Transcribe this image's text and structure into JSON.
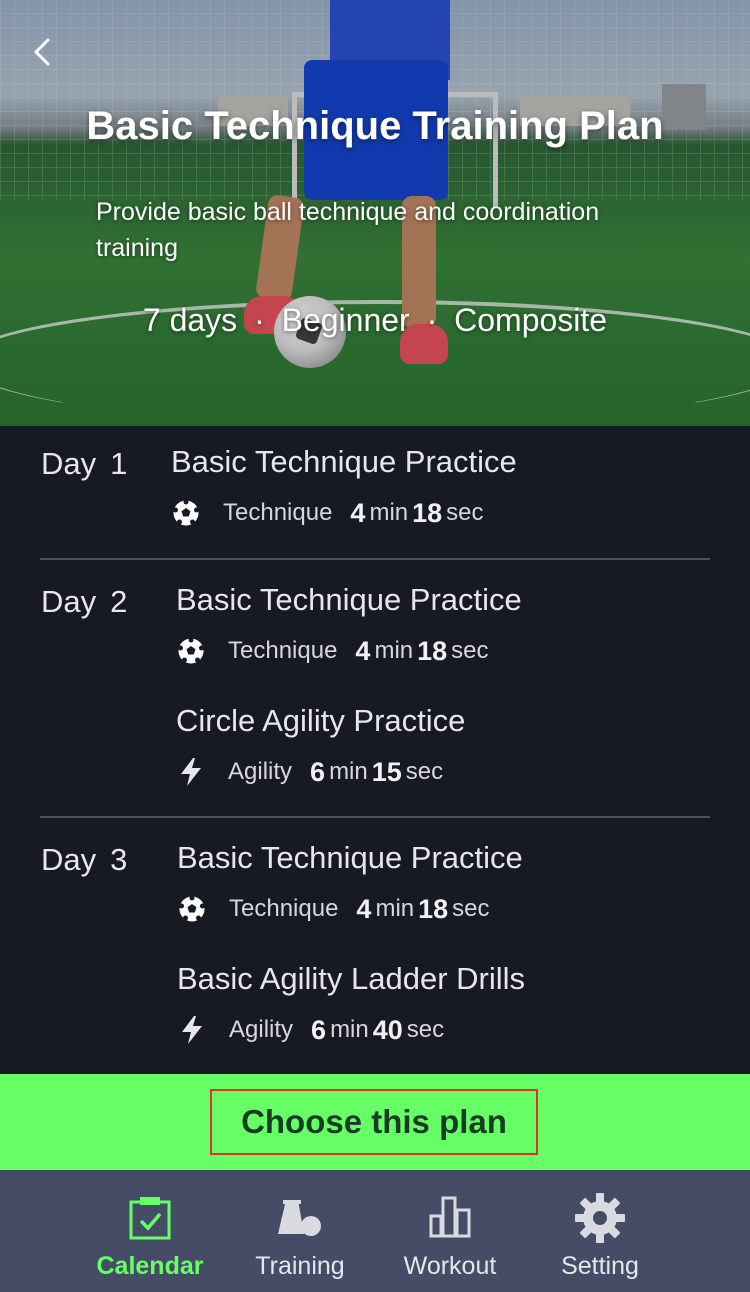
{
  "header": {
    "title": "Basic Technique Training Plan",
    "subtitle": "Provide basic ball technique and coordination training",
    "meta": {
      "duration": "7 days",
      "level": "Beginner",
      "type": "Composite",
      "separator": "·"
    }
  },
  "days": [
    {
      "label": "Day",
      "number": "1",
      "exercises": [
        {
          "title": "Basic Technique Practice",
          "icon": "soccer-ball-icon",
          "category": "Technique",
          "minutes": "4",
          "min_unit": "min",
          "seconds": "18",
          "sec_unit": "sec"
        }
      ]
    },
    {
      "label": "Day",
      "number": "2",
      "exercises": [
        {
          "title": "Basic Technique Practice",
          "icon": "soccer-ball-icon",
          "category": "Technique",
          "minutes": "4",
          "min_unit": "min",
          "seconds": "18",
          "sec_unit": "sec"
        },
        {
          "title": "Circle Agility Practice",
          "icon": "lightning-icon",
          "category": "Agility",
          "minutes": "6",
          "min_unit": "min",
          "seconds": "15",
          "sec_unit": "sec"
        }
      ]
    },
    {
      "label": "Day",
      "number": "3",
      "exercises": [
        {
          "title": "Basic Technique Practice",
          "icon": "soccer-ball-icon",
          "category": "Technique",
          "minutes": "4",
          "min_unit": "min",
          "seconds": "18",
          "sec_unit": "sec"
        },
        {
          "title": "Basic Agility Ladder Drills",
          "icon": "lightning-icon",
          "category": "Agility",
          "minutes": "6",
          "min_unit": "min",
          "seconds": "40",
          "sec_unit": "sec"
        }
      ]
    }
  ],
  "cta": {
    "label": "Choose this plan"
  },
  "tabs": [
    {
      "label": "Calendar",
      "icon": "calendar-check-icon",
      "active": true
    },
    {
      "label": "Training",
      "icon": "cone-ball-icon",
      "active": false
    },
    {
      "label": "Workout",
      "icon": "bar-chart-icon",
      "active": false
    },
    {
      "label": "Setting",
      "icon": "gear-icon",
      "active": false
    }
  ],
  "colors": {
    "accent": "#66ff66",
    "background": "#171a23",
    "tabbar": "#454d66",
    "cta_border": "#e0302f"
  }
}
